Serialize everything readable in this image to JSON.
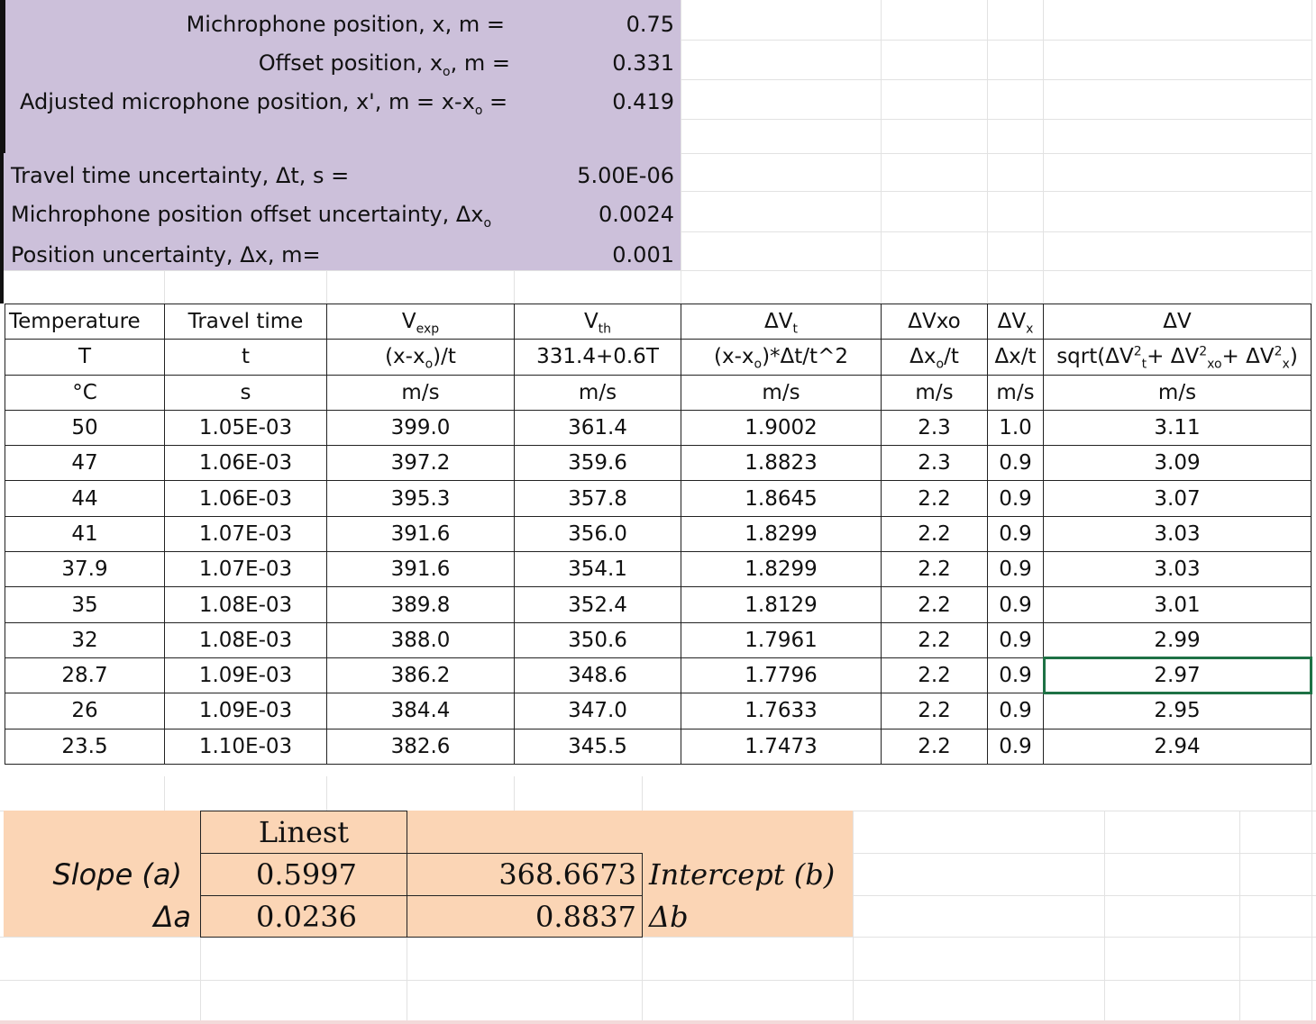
{
  "params": [
    {
      "label_html": "Michrophone position, x, m =",
      "value": "0.75"
    },
    {
      "label_html": "Offset position, x<sub>o</sub>, m =",
      "value": "0.331"
    },
    {
      "label_html": "Adjusted microphone position, x', m = x-x<sub>o</sub> =",
      "value": "0.419"
    },
    {
      "label_html": "Travel time uncertainty, Δt, s =",
      "value": "5.00E-06"
    },
    {
      "label_html": "Michrophone position offset uncertainty, Δx<sub>o</sub>",
      "value": "0.0024"
    },
    {
      "label_html": "Position uncertainty, Δx, m=",
      "value": "0.001"
    }
  ],
  "table": {
    "header_names": [
      "Temperature",
      "Travel time",
      "V<sub>exp</sub>",
      "V<sub>th</sub>",
      "ΔV<sub>t</sub>",
      "ΔVxo",
      "ΔV<sub>x</sub>",
      "ΔV"
    ],
    "header_symbols": [
      "T",
      "t",
      "(x-x<sub>o</sub>)/t",
      "331.4+0.6T",
      "(x-x<sub>o</sub>)*Δt/t^2",
      "Δx<sub>o</sub>/t",
      "Δx/t",
      "sqrt(ΔV<sup>2</sup><sub>t</sub>+ ΔV<sup>2</sup><sub>xo</sub>+ ΔV<sup>2</sup><sub>x</sub>)"
    ],
    "header_units": [
      "°C",
      "s",
      "m/s",
      "m/s",
      "m/s",
      "m/s",
      "m/s",
      "m/s"
    ],
    "rows": [
      [
        "50",
        "1.05E-03",
        "399.0",
        "361.4",
        "1.9002",
        "2.3",
        "1.0",
        "3.11"
      ],
      [
        "47",
        "1.06E-03",
        "397.2",
        "359.6",
        "1.8823",
        "2.3",
        "0.9",
        "3.09"
      ],
      [
        "44",
        "1.06E-03",
        "395.3",
        "357.8",
        "1.8645",
        "2.2",
        "0.9",
        "3.07"
      ],
      [
        "41",
        "1.07E-03",
        "391.6",
        "356.0",
        "1.8299",
        "2.2",
        "0.9",
        "3.03"
      ],
      [
        "37.9",
        "1.07E-03",
        "391.6",
        "354.1",
        "1.8299",
        "2.2",
        "0.9",
        "3.03"
      ],
      [
        "35",
        "1.08E-03",
        "389.8",
        "352.4",
        "1.8129",
        "2.2",
        "0.9",
        "3.01"
      ],
      [
        "32",
        "1.08E-03",
        "388.0",
        "350.6",
        "1.7961",
        "2.2",
        "0.9",
        "2.99"
      ],
      [
        "28.7",
        "1.09E-03",
        "386.2",
        "348.6",
        "1.7796",
        "2.2",
        "0.9",
        "2.97"
      ],
      [
        "26",
        "1.09E-03",
        "384.4",
        "347.0",
        "1.7633",
        "2.2",
        "0.9",
        "2.95"
      ],
      [
        "23.5",
        "1.10E-03",
        "382.6",
        "345.5",
        "1.7473",
        "2.2",
        "0.9",
        "2.94"
      ]
    ],
    "selected_row": 7,
    "selected_col": 7
  },
  "linest": {
    "header": "Linest",
    "slope_label": "Slope (a)",
    "slope": "0.5997",
    "delta_a_label": "Δa",
    "delta_a": "0.0236",
    "intercept": "368.6673",
    "intercept_label": "Intercept (b)",
    "delta_b": "0.8837",
    "delta_b_label": "Δb"
  },
  "colors": {
    "params_bg": "#ccc0da",
    "linest_bg": "#fbd5b5",
    "selection": "#1e7145"
  }
}
